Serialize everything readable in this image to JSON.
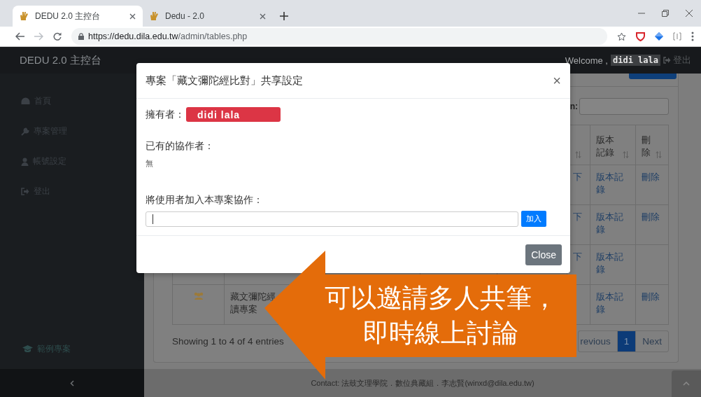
{
  "browser": {
    "tabs": [
      {
        "title": "DEDU 2.0 主控台",
        "selected": true
      },
      {
        "title": "Dedu - 2.0",
        "selected": false
      }
    ],
    "url_host": "https://dedu.dila.edu.tw",
    "url_path": "/admin/tables.php"
  },
  "navbar": {
    "brand": "DEDU 2.0 主控台",
    "welcome": "Welcome ,",
    "user": "didi lala",
    "logout": "登出"
  },
  "sidebar": {
    "items": [
      {
        "label": "首頁"
      },
      {
        "label": "專案管理"
      },
      {
        "label": "帳號設定"
      },
      {
        "label": "登出"
      }
    ],
    "example_link": "範例專案"
  },
  "table": {
    "search_label": "n:",
    "columns": [
      {
        "sortable": true
      },
      {
        "label": "版本記錄",
        "sortable": true
      },
      {
        "label": "刪除",
        "sortable": true
      }
    ],
    "rows": [
      {
        "link_fragment": "下",
        "version": "版本記錄",
        "delete": "刪除"
      },
      {
        "link_fragment": "下",
        "version": "版本記錄",
        "delete": "刪除"
      },
      {
        "link_fragment": "下",
        "version": "版本記錄"
      },
      {
        "has_icon": true,
        "title_lines": [
          "藏文彌陀經",
          "讀專案"
        ],
        "version": "版本記錄",
        "delete": "刪除"
      }
    ],
    "info": "Showing 1 to 4 of 4 entries",
    "pagination": [
      {
        "label": "revious",
        "selected": false
      },
      {
        "label": "1",
        "selected": true
      },
      {
        "label": "Next",
        "selected": false
      }
    ]
  },
  "modal": {
    "title": "專案「藏文彌陀經比對」共享設定",
    "close": "×",
    "owner_label": "擁有者：",
    "owner": "didi lala",
    "collaborators_label": "已有的協作者：",
    "collaborators_empty": "無",
    "add_label": "將使用者加入本專案協作：",
    "add_button": "加入",
    "close_button": "Close"
  },
  "callout": {
    "lines": [
      "可以邀請多人共筆，",
      "即時線上討論"
    ]
  },
  "footer": {
    "contact": "Contact: 法鼓文理學院．數位典藏組．李志賢(winxd@dila.edu.tw)"
  }
}
